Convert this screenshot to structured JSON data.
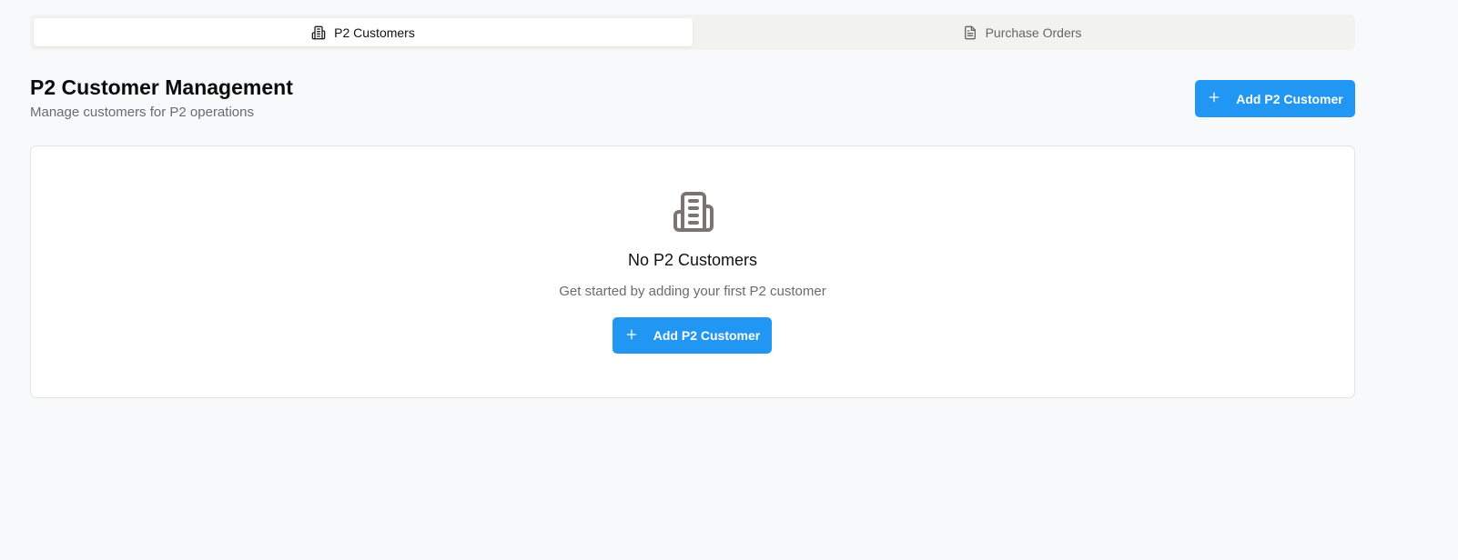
{
  "tabs": [
    {
      "label": "P2 Customers",
      "icon": "building-icon",
      "active": true
    },
    {
      "label": "Purchase Orders",
      "icon": "document-icon",
      "active": false
    }
  ],
  "header": {
    "title": "P2 Customer Management",
    "subtitle": "Manage customers for P2 operations",
    "add_button_label": "Add P2 Customer"
  },
  "empty_state": {
    "icon": "building-icon",
    "title": "No P2 Customers",
    "description": "Get started by adding your first P2 customer",
    "add_button_label": "Add P2 Customer"
  },
  "colors": {
    "accent": "#2196f3",
    "background": "#f8f9fa",
    "tab_bar": "#f2f2f0",
    "muted_text": "#6b6b6b"
  }
}
